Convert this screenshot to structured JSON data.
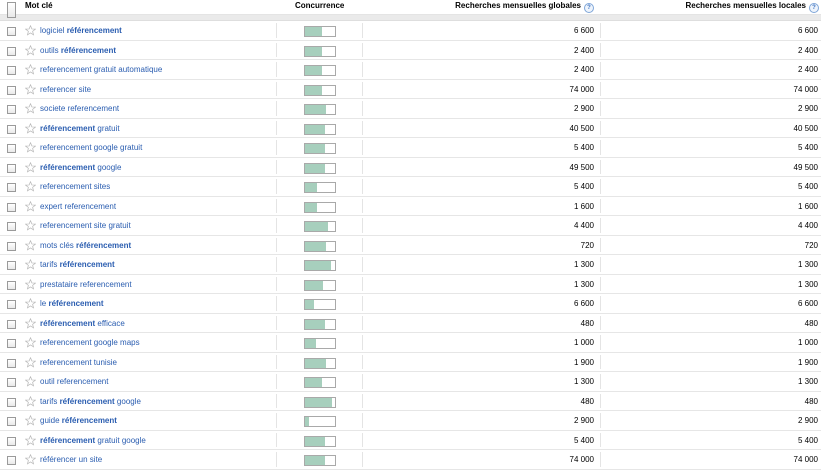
{
  "header": {
    "keyword_label": "Mot clé",
    "competition_label": "Concurrence",
    "global_label": "Recherches mensuelles globales",
    "local_label": "Recherches mensuelles locales",
    "help_glyph": "?"
  },
  "rows": [
    {
      "pre": "logiciel ",
      "bold": "référencement",
      "post": "",
      "competition": 0.55,
      "global": "6 600",
      "local": "6 600"
    },
    {
      "pre": "outils ",
      "bold": "référencement",
      "post": "",
      "competition": 0.55,
      "global": "2 400",
      "local": "2 400"
    },
    {
      "pre": "referencement gratuit automatique",
      "bold": "",
      "post": "",
      "competition": 0.55,
      "global": "2 400",
      "local": "2 400"
    },
    {
      "pre": "referencer site",
      "bold": "",
      "post": "",
      "competition": 0.55,
      "global": "74 000",
      "local": "74 000"
    },
    {
      "pre": "societe referencement",
      "bold": "",
      "post": "",
      "competition": 0.7,
      "global": "2 900",
      "local": "2 900"
    },
    {
      "pre": "",
      "bold": "référencement",
      "post": " gratuit",
      "competition": 0.65,
      "global": "40 500",
      "local": "40 500"
    },
    {
      "pre": "referencement google gratuit",
      "bold": "",
      "post": "",
      "competition": 0.65,
      "global": "5 400",
      "local": "5 400"
    },
    {
      "pre": "",
      "bold": "référencement",
      "post": " google",
      "competition": 0.65,
      "global": "49 500",
      "local": "49 500"
    },
    {
      "pre": "referencement sites",
      "bold": "",
      "post": "",
      "competition": 0.4,
      "global": "5 400",
      "local": "5 400"
    },
    {
      "pre": "expert referencement",
      "bold": "",
      "post": "",
      "competition": 0.4,
      "global": "1 600",
      "local": "1 600"
    },
    {
      "pre": "referencement site gratuit",
      "bold": "",
      "post": "",
      "competition": 0.75,
      "global": "4 400",
      "local": "4 400"
    },
    {
      "pre": "mots clés ",
      "bold": "référencement",
      "post": "",
      "competition": 0.7,
      "global": "720",
      "local": "720"
    },
    {
      "pre": "tarifs ",
      "bold": "référencement",
      "post": "",
      "competition": 0.85,
      "global": "1 300",
      "local": "1 300"
    },
    {
      "pre": "prestataire referencement",
      "bold": "",
      "post": "",
      "competition": 0.6,
      "global": "1 300",
      "local": "1 300"
    },
    {
      "pre": "le ",
      "bold": "référencement",
      "post": "",
      "competition": 0.3,
      "global": "6 600",
      "local": "6 600"
    },
    {
      "pre": "",
      "bold": "référencement",
      "post": " efficace",
      "competition": 0.65,
      "global": "480",
      "local": "480"
    },
    {
      "pre": "referencement google maps",
      "bold": "",
      "post": "",
      "competition": 0.35,
      "global": "1 000",
      "local": "1 000"
    },
    {
      "pre": "referencement tunisie",
      "bold": "",
      "post": "",
      "competition": 0.7,
      "global": "1 900",
      "local": "1 900"
    },
    {
      "pre": "outil referencement",
      "bold": "",
      "post": "",
      "competition": 0.55,
      "global": "1 300",
      "local": "1 300"
    },
    {
      "pre": "tarifs ",
      "bold": "référencement",
      "post": " google",
      "competition": 0.9,
      "global": "480",
      "local": "480"
    },
    {
      "pre": "guide ",
      "bold": "référencement",
      "post": "",
      "competition": 0.12,
      "global": "2 900",
      "local": "2 900"
    },
    {
      "pre": "",
      "bold": "référencement",
      "post": " gratuit google",
      "competition": 0.65,
      "global": "5 400",
      "local": "5 400"
    },
    {
      "pre": "référencer un site",
      "bold": "",
      "post": "",
      "competition": 0.65,
      "global": "74 000",
      "local": "74 000"
    }
  ],
  "colors": {
    "link": "#2a5db0",
    "bar_fill": "#a7cfbd",
    "bar_border": "#a9a9a9"
  },
  "icons": {
    "row_star": "star-outline-icon",
    "checkbox": "checkbox-icon",
    "help": "help-icon"
  }
}
